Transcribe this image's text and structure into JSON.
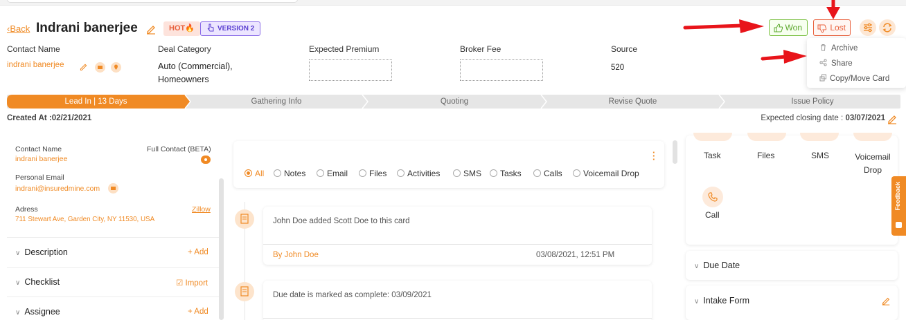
{
  "header": {
    "back_label": "Back",
    "contact_title": "Indrani banerjee",
    "hot_badge": "HOT",
    "version_badge": "VERSION 2",
    "won_label": "Won",
    "lost_label": "Lost"
  },
  "menu": {
    "archive": "Archive",
    "share": "Share",
    "copy_move": "Copy/Move Card"
  },
  "fields": {
    "contact_name_label": "Contact Name",
    "contact_name_value": "indrani banerjee",
    "deal_category_label": "Deal Category",
    "deal_category_line1": "Auto (Commercial),",
    "deal_category_line2": "Homeowners",
    "expected_premium_label": "Expected Premium",
    "broker_fee_label": "Broker Fee",
    "source_label": "Source",
    "source_value": "520"
  },
  "pipeline": {
    "stages": [
      "Lead In | 13 Days",
      "Gathering Info",
      "Quoting",
      "Revise Quote",
      "Issue Policy"
    ]
  },
  "dates": {
    "created_label": "Created At :",
    "created_value": "02/21/2021",
    "closing_label": "Expected closing date :",
    "closing_value": "03/07/2021"
  },
  "left_panel": {
    "contact_name_label": "Contact Name",
    "contact_name_value": "indrani banerjee",
    "full_contact_label": "Full Contact (BETA)",
    "personal_email_label": "Personal Email",
    "personal_email_value": "indrani@insuredmine.com",
    "address_label": "Adress",
    "zillow_link": "Zillow",
    "address_value": "711 Stewart Ave, Garden City, NY 11530, USA",
    "sections": [
      {
        "title": "Description",
        "action": "+ Add"
      },
      {
        "title": "Checklist",
        "action": "Import"
      },
      {
        "title": "Assignee",
        "action": "+ Add"
      }
    ]
  },
  "activity": {
    "filters": [
      "All",
      "Notes",
      "Email",
      "Files",
      "Activities",
      "SMS",
      "Tasks",
      "Calls",
      "Voicemail Drop"
    ],
    "items": [
      {
        "text": "John Doe added Scott Doe to this card",
        "by": "By John Doe",
        "time": "03/08/2021, 12:51 PM"
      },
      {
        "text": "Due date is marked as complete: 03/09/2021"
      }
    ]
  },
  "right_panel": {
    "actions": [
      "Task",
      "Files",
      "SMS",
      "Voicemail",
      "Drop",
      "Call"
    ],
    "sections": [
      "Due Date",
      "Intake Form"
    ]
  },
  "feedback_label": "Feedback",
  "colors": {
    "accent": "#f08a24",
    "won": "#5ba82c",
    "lost": "#e8603c",
    "version": "#5a3fd1",
    "annotation_arrow": "#e8141a"
  }
}
